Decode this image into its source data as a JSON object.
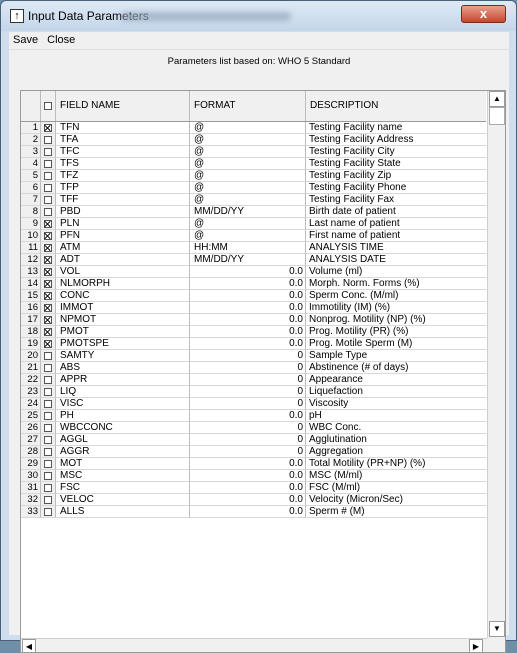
{
  "window": {
    "title": "Input Data Parameters",
    "close_glyph": "x"
  },
  "menu": [
    "Save",
    "Close"
  ],
  "based_on": "Parameters list based on:  WHO 5  Standard",
  "columns": {
    "field": "FIELD NAME",
    "format": "FORMAT",
    "description": "DESCRIPTION"
  },
  "rows": [
    {
      "n": "1",
      "checked": true,
      "field": "TFN",
      "format": "@",
      "desc": "Testing Facility name"
    },
    {
      "n": "2",
      "checked": false,
      "field": "TFA",
      "format": "@",
      "desc": "Testing Facility Address"
    },
    {
      "n": "3",
      "checked": false,
      "field": "TFC",
      "format": "@",
      "desc": "Testing Facility City"
    },
    {
      "n": "4",
      "checked": false,
      "field": "TFS",
      "format": "@",
      "desc": "Testing Facility State"
    },
    {
      "n": "5",
      "checked": false,
      "field": "TFZ",
      "format": "@",
      "desc": "Testing Facility Zip"
    },
    {
      "n": "6",
      "checked": false,
      "field": "TFP",
      "format": "@",
      "desc": "Testing Facility Phone"
    },
    {
      "n": "7",
      "checked": false,
      "field": "TFF",
      "format": "@",
      "desc": "Testing Facility Fax"
    },
    {
      "n": "8",
      "checked": false,
      "field": "PBD",
      "format": "MM/DD/YY",
      "desc": "Birth date of patient"
    },
    {
      "n": "9",
      "checked": true,
      "field": "PLN",
      "format": "@",
      "desc": "Last name of patient"
    },
    {
      "n": "10",
      "checked": true,
      "field": "PFN",
      "format": "@",
      "desc": "First name of patient"
    },
    {
      "n": "11",
      "checked": true,
      "field": "ATM",
      "format": "HH:MM",
      "desc": "ANALYSIS TIME"
    },
    {
      "n": "12",
      "checked": true,
      "field": "ADT",
      "format": "MM/DD/YY",
      "desc": "ANALYSIS DATE"
    },
    {
      "n": "13",
      "checked": true,
      "field": "VOL",
      "format": "0.0",
      "num": true,
      "desc": "Volume (ml)"
    },
    {
      "n": "14",
      "checked": true,
      "field": "NLMORPH",
      "format": "0.0",
      "num": true,
      "desc": "Morph. Norm. Forms (%)"
    },
    {
      "n": "15",
      "checked": true,
      "field": "CONC",
      "format": "0.0",
      "num": true,
      "desc": "Sperm Conc. (M/ml)"
    },
    {
      "n": "16",
      "checked": true,
      "field": "IMMOT",
      "format": "0.0",
      "num": true,
      "desc": "Immotility (IM) (%)"
    },
    {
      "n": "17",
      "checked": true,
      "field": "NPMOT",
      "format": "0.0",
      "num": true,
      "desc": "Nonprog. Motility (NP) (%)"
    },
    {
      "n": "18",
      "checked": true,
      "field": "PMOT",
      "format": "0.0",
      "num": true,
      "desc": "Prog. Motility (PR) (%)"
    },
    {
      "n": "19",
      "checked": true,
      "field": "PMOTSPE",
      "format": "0.0",
      "num": true,
      "desc": "Prog. Motile Sperm (M)"
    },
    {
      "n": "20",
      "checked": false,
      "field": "SAMTY",
      "format": "0",
      "num": true,
      "desc": "Sample Type"
    },
    {
      "n": "21",
      "checked": false,
      "field": "ABS",
      "format": "0",
      "num": true,
      "desc": "Abstinence (# of days)"
    },
    {
      "n": "22",
      "checked": false,
      "field": "APPR",
      "format": "0",
      "num": true,
      "desc": "Appearance"
    },
    {
      "n": "23",
      "checked": false,
      "field": "LIQ",
      "format": "0",
      "num": true,
      "desc": "Liquefaction"
    },
    {
      "n": "24",
      "checked": false,
      "field": "VISC",
      "format": "0",
      "num": true,
      "desc": "Viscosity"
    },
    {
      "n": "25",
      "checked": false,
      "field": "PH",
      "format": "0.0",
      "num": true,
      "desc": "pH"
    },
    {
      "n": "26",
      "checked": false,
      "field": "WBCCONC",
      "format": "0",
      "num": true,
      "desc": "WBC Conc."
    },
    {
      "n": "27",
      "checked": false,
      "field": "AGGL",
      "format": "0",
      "num": true,
      "desc": "Agglutination"
    },
    {
      "n": "28",
      "checked": false,
      "field": "AGGR",
      "format": "0",
      "num": true,
      "desc": "Aggregation"
    },
    {
      "n": "29",
      "checked": false,
      "field": "MOT",
      "format": "0.0",
      "num": true,
      "desc": "Total Motility (PR+NP) (%)"
    },
    {
      "n": "30",
      "checked": false,
      "field": "MSC",
      "format": "0.0",
      "num": true,
      "desc": "MSC (M/ml)"
    },
    {
      "n": "31",
      "checked": false,
      "field": "FSC",
      "format": "0.0",
      "num": true,
      "desc": "FSC (M/ml)"
    },
    {
      "n": "32",
      "checked": false,
      "field": "VELOC",
      "format": "0.0",
      "num": true,
      "desc": "Velocity (Micron/Sec)"
    },
    {
      "n": "33",
      "checked": false,
      "field": "ALLS",
      "format": "0.0",
      "num": true,
      "desc": "Sperm # (M)"
    }
  ],
  "icons": {
    "app": "up-arrow-app-icon",
    "scroll_up": "▲",
    "scroll_down": "▼",
    "scroll_left": "◀",
    "scroll_right": "▶"
  }
}
